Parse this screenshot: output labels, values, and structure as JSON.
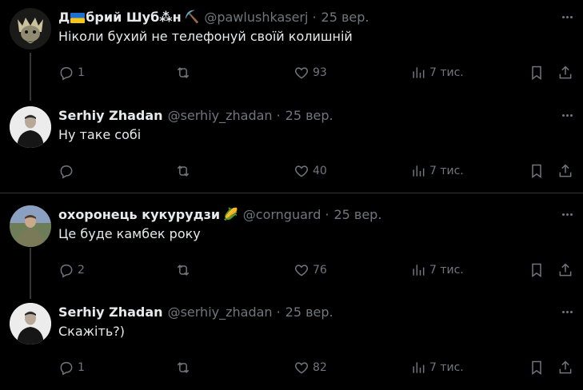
{
  "tweets": [
    {
      "name": "Д🇺🇦брий Шуб⁂н",
      "name_emoji": "⛏️",
      "handle": "@pawlushkaserj",
      "date": "25 вер.",
      "text": "Ніколи бухий не телефонуй своїй колишній",
      "reply_count": "1",
      "like_count": "93",
      "views": "7 тис."
    },
    {
      "name": "Serhiy Zhadan",
      "handle": "@serhiy_zhadan",
      "date": "25 вер.",
      "text": "Ну таке собі",
      "reply_count": "",
      "like_count": "40",
      "views": "7 тис."
    },
    {
      "name": "охоронець кукурудзи",
      "name_emoji": "🌽",
      "handle": "@cornguard",
      "date": "25 вер.",
      "text": "Це буде камбек року",
      "reply_count": "2",
      "like_count": "76",
      "views": "7 тис."
    },
    {
      "name": "Serhiy Zhadan",
      "handle": "@serhiy_zhadan",
      "date": "25 вер.",
      "text": "Скажіть?)",
      "reply_count": "1",
      "like_count": "82",
      "views": "7 тис."
    }
  ],
  "separator": "·",
  "colors": {
    "background": "#000000",
    "text": "#e7e9ea",
    "secondary": "#71767b",
    "divider": "#2f3336"
  }
}
